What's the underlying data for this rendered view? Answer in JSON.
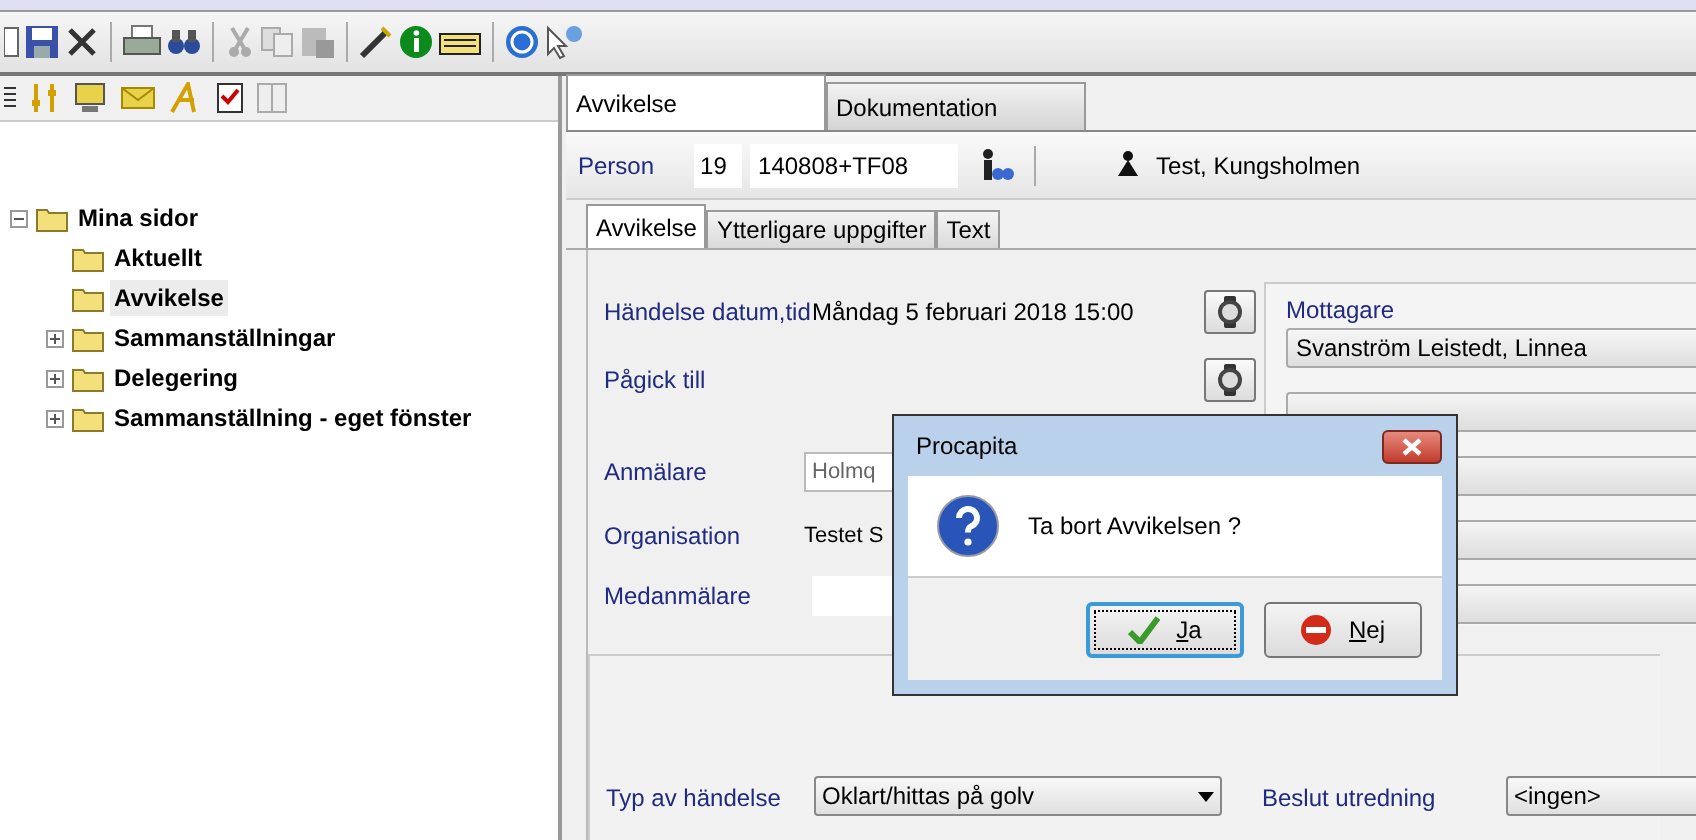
{
  "tree": [
    {
      "label": "Mina sidor",
      "expanded": true,
      "selected": false,
      "children": [
        {
          "label": "Aktuellt",
          "selected": false
        },
        {
          "label": "Avvikelse",
          "selected": true
        },
        {
          "label": "Sammanställningar",
          "expanded": false,
          "selected": false
        },
        {
          "label": "Delegering",
          "expanded": false,
          "selected": false
        },
        {
          "label": "Sammanställning - eget fönster",
          "expanded": false,
          "selected": false
        }
      ]
    }
  ],
  "tabs": [
    {
      "label": "Avvikelse",
      "selected": true
    },
    {
      "label": "Dokumentation",
      "selected": false
    }
  ],
  "person": {
    "label": "Person",
    "century": "19",
    "number": "140808+TF08",
    "name": "Test, Kungsholmen"
  },
  "subtabs": [
    {
      "label": "Avvikelse",
      "selected": true
    },
    {
      "label": "Ytterligare uppgifter",
      "selected": false
    },
    {
      "label": "Text",
      "selected": false
    }
  ],
  "form": {
    "event_datetime": {
      "label": "Händelse datum,tid",
      "value": "Måndag 5 februari 2018 15:00"
    },
    "lasted_until": {
      "label": "Pågick till"
    },
    "reporter": {
      "label": "Anmälare",
      "value": "Holmq"
    },
    "organisation": {
      "label": "Organisation",
      "value": "Testet S"
    },
    "co_reporter": {
      "label": "Medanmälare"
    },
    "recipient": {
      "label": "Mottagare",
      "value": "Svanström Leistedt, Linnea"
    },
    "event_type": {
      "label": "Typ av händelse",
      "value": "Oklart/hittas på golv"
    },
    "decision": {
      "label": "Beslut utredning",
      "value": "<ingen>"
    }
  },
  "dialog": {
    "title": "Procapita",
    "message": "Ta bort Avvikelsen ?",
    "buttons": [
      {
        "label": "Ja",
        "kind": "yes",
        "focused": true
      },
      {
        "label": "Nej",
        "kind": "no",
        "focused": false
      }
    ]
  }
}
